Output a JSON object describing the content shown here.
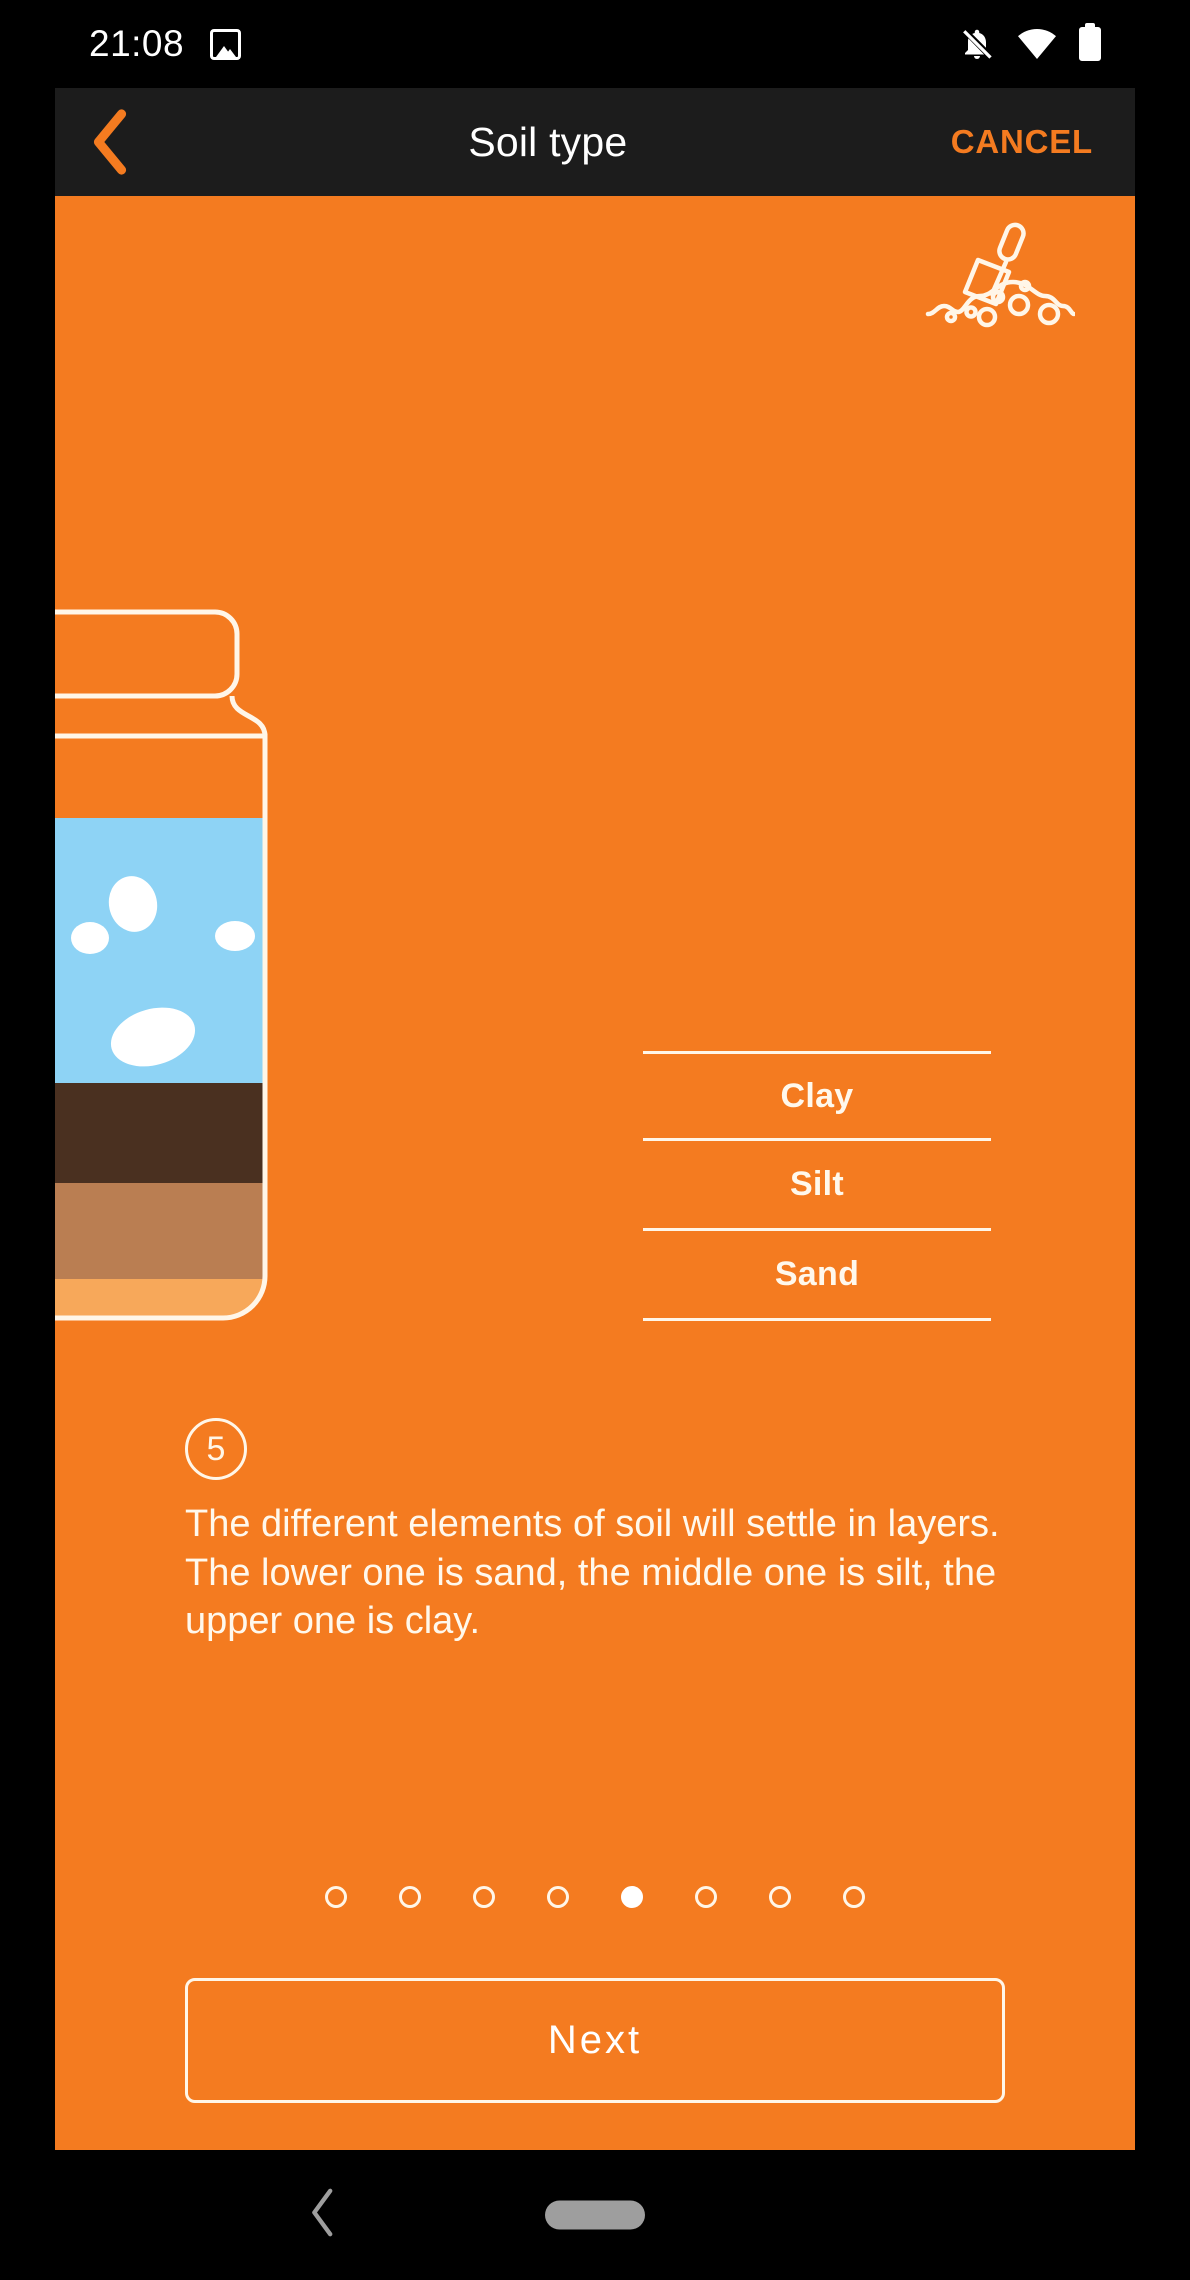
{
  "statusbar": {
    "time": "21:08",
    "icons": [
      "image-icon",
      "bell-off-icon",
      "wifi-icon",
      "battery-icon"
    ]
  },
  "appbar": {
    "back_icon": "chevron-left-icon",
    "title": "Soil type",
    "cancel_label": "CANCEL"
  },
  "content": {
    "decoration_icon": "shovel-in-soil-icon",
    "jar": {
      "layers": [
        {
          "name": "water",
          "color": "#8ed3f5"
        },
        {
          "name": "clay",
          "color": "#4a3020"
        },
        {
          "name": "silt",
          "color": "#ba7e52"
        },
        {
          "name": "sand",
          "color": "#f7a85a"
        }
      ],
      "outline_color": "#FFF6E8"
    },
    "labels": [
      {
        "text": "Clay"
      },
      {
        "text": "Silt"
      },
      {
        "text": "Sand"
      }
    ],
    "step": {
      "number": "5",
      "text": "The different elements of soil will settle in layers. The lower one is sand, the middle one is silt, the upper one is clay."
    },
    "pagination": {
      "total": 8,
      "active_index": 4
    },
    "next_label": "Next"
  },
  "navbar": {
    "back_icon": "chevron-left-icon",
    "home_pill": "gesture-pill"
  },
  "colors": {
    "background": "#F47B20",
    "appbar": "#1c1c1c",
    "accent": "#F47B20",
    "cream": "#FFF6E8"
  }
}
